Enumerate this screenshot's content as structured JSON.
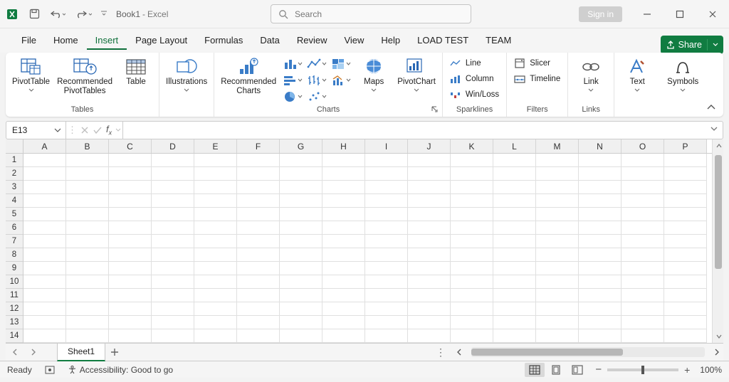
{
  "title": {
    "doc": "Book1",
    "app": "Excel"
  },
  "search_placeholder": "Search",
  "sign_in": "Sign in",
  "share": "Share",
  "menus": [
    "File",
    "Home",
    "Insert",
    "Page Layout",
    "Formulas",
    "Data",
    "Review",
    "View",
    "Help",
    "LOAD TEST",
    "TEAM"
  ],
  "active_menu_index": 2,
  "ribbon": {
    "tables": {
      "label": "Tables",
      "pivot": "PivotTable",
      "recommended": "Recommended\nPivotTables",
      "table": "Table"
    },
    "illustrations": "Illustrations",
    "charts": {
      "recommended": "Recommended\nCharts",
      "label": "Charts",
      "maps": "Maps",
      "pivotchart": "PivotChart"
    },
    "sparklines": {
      "label": "Sparklines",
      "line": "Line",
      "column": "Column",
      "winloss": "Win/Loss"
    },
    "filters": {
      "label": "Filters",
      "slicer": "Slicer",
      "timeline": "Timeline"
    },
    "links": {
      "label": "Links",
      "link": "Link"
    },
    "text": "Text",
    "symbols": "Symbols"
  },
  "cell_ref": "E13",
  "columns": [
    "A",
    "B",
    "C",
    "D",
    "E",
    "F",
    "G",
    "H",
    "I",
    "J",
    "K",
    "L",
    "M",
    "N",
    "O",
    "P"
  ],
  "rows_visible": 14,
  "sheet_tab": "Sheet1",
  "status": {
    "ready": "Ready",
    "accessibility": "Accessibility: Good to go",
    "zoom": "100%"
  }
}
